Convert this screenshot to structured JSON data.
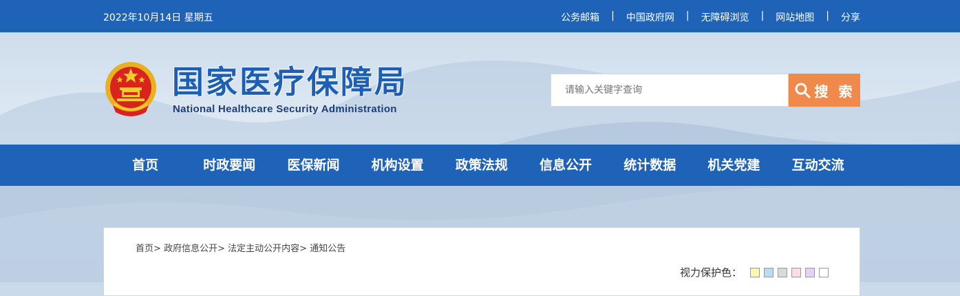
{
  "topbar": {
    "date": "2022年10月14日 星期五",
    "links": [
      "公务邮箱",
      "中国政府网",
      "无障碍浏览",
      "网站地图",
      "分享"
    ],
    "separator": "|"
  },
  "header": {
    "title_cn": "国家医疗保障局",
    "title_en": "National Healthcare Security Administration",
    "emblem_icon": "national-emblem-icon"
  },
  "search": {
    "placeholder": "请输入关键字查询",
    "button_label": "搜 索",
    "button_icon": "search-icon"
  },
  "nav": {
    "items": [
      "首页",
      "时政要闻",
      "医保新闻",
      "机构设置",
      "政策法规",
      "信息公开",
      "统计数据",
      "机关党建",
      "互动交流"
    ]
  },
  "breadcrumb": {
    "items": [
      "首页",
      "政府信息公开",
      "法定主动公开内容",
      "通知公告"
    ],
    "separator": ">"
  },
  "eye_protection": {
    "label": "视力保护色：",
    "swatches": [
      "#faf7b4",
      "#b9dcf0",
      "#d9d9d9",
      "#fbdde7",
      "#e5d1f5",
      "#ffffff"
    ]
  },
  "colors": {
    "primary": "#1f63b8",
    "accent": "#ef8a4b"
  }
}
